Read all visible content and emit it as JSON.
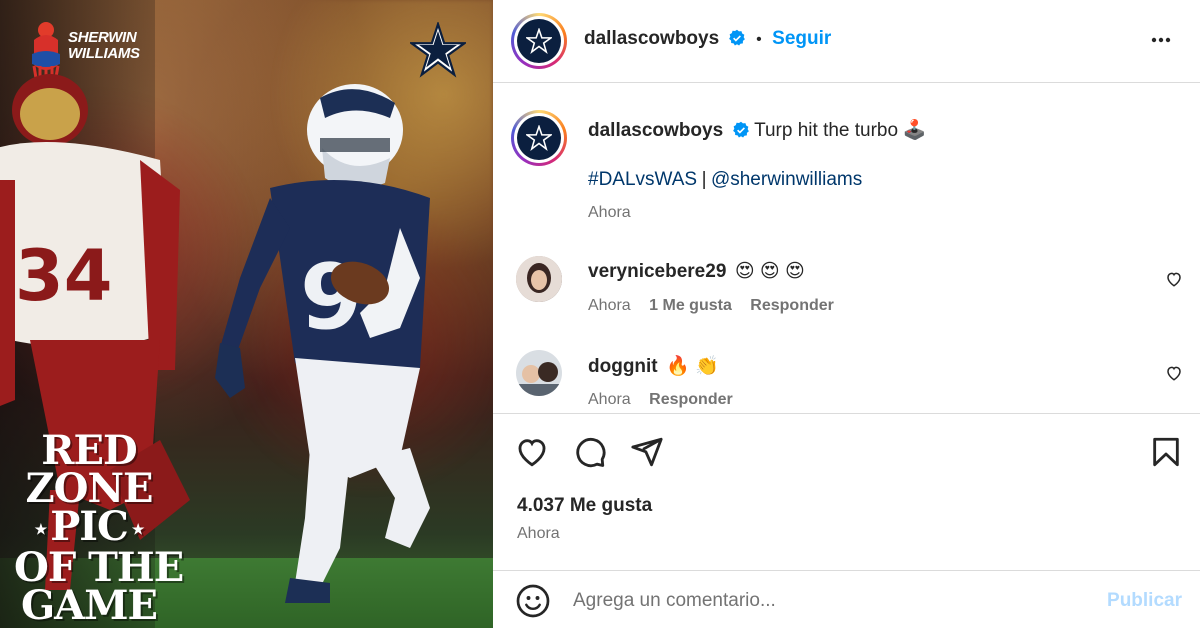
{
  "media": {
    "sponsor_line1": "SHERWIN",
    "sponsor_line2": "WILLIAMS",
    "promo_line1": "RED",
    "promo_line2": "ZONE",
    "promo_line3": "PIC",
    "promo_line4": "OF THE",
    "promo_line5": "GAME",
    "jersey_defender": "34",
    "jersey_player": "9"
  },
  "header": {
    "username": "dallascowboys",
    "separator": "•",
    "follow_label": "Seguir"
  },
  "caption": {
    "username": "dallascowboys",
    "text": "Turp hit the turbo",
    "emoji": "🕹️",
    "hashtag": "#DALvsWAS",
    "separator": "|",
    "mention": "@sherwinwilliams",
    "time": "Ahora"
  },
  "comments": [
    {
      "username": "verynicebere29",
      "text": "😍 😍 😍",
      "time": "Ahora",
      "likes": "1 Me gusta",
      "reply": "Responder"
    },
    {
      "username": "doggnit",
      "text": "🔥 👏",
      "time": "Ahora",
      "reply": "Responder"
    }
  ],
  "actions": {
    "likes": "4.037 Me gusta",
    "time": "Ahora"
  },
  "add_comment": {
    "placeholder": "Agrega un comentario...",
    "publish_label": "Publicar"
  },
  "colors": {
    "link_blue": "#0095f6",
    "hashtag_blue": "#00376b",
    "publish_disabled": "#b3dbff",
    "cowboys_navy": "#0b1f3f"
  }
}
